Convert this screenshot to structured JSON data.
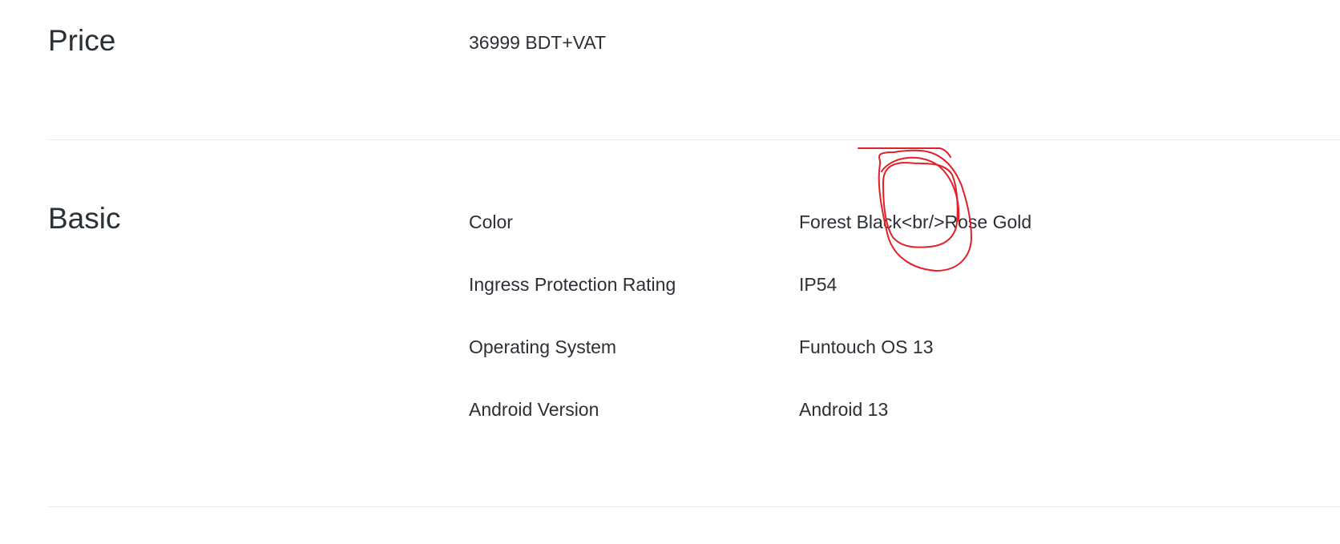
{
  "price_section": {
    "title": "Price",
    "value": "36999 BDT+VAT"
  },
  "basic_section": {
    "title": "Basic",
    "rows": [
      {
        "label": "Color",
        "value": "Forest Black<br/>Rose Gold"
      },
      {
        "label": "Ingress Protection Rating",
        "value": "IP54"
      },
      {
        "label": "Operating System",
        "value": "Funtouch OS 13"
      },
      {
        "label": "Android Version",
        "value": "Android 13"
      }
    ]
  },
  "annotation": {
    "stroke_color": "#e3202a"
  }
}
